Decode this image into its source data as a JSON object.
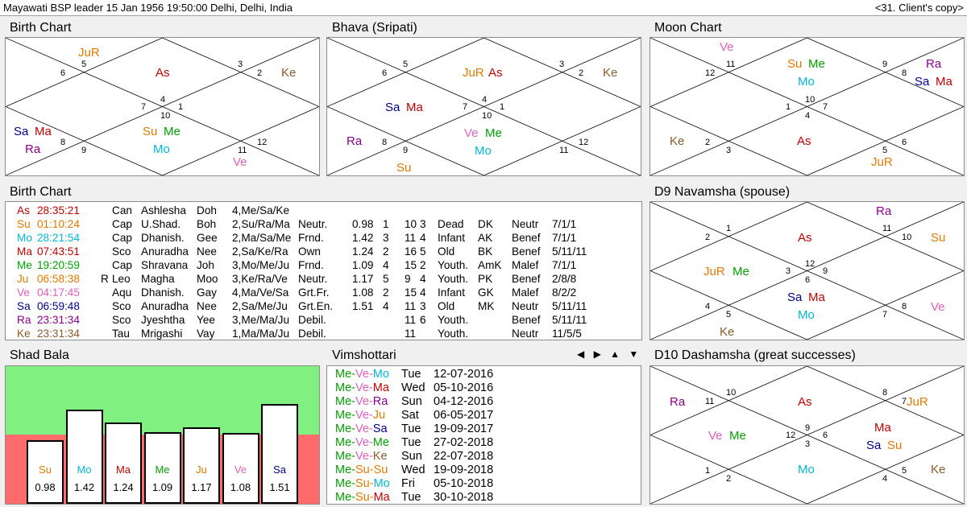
{
  "header": {
    "title": "Mayawati BSP leader  15 Jan 1956 19:50:00   Delhi, Delhi, India",
    "copy_label": "<31. Client's copy>"
  },
  "colors": {
    "Su": "#e07a00",
    "Mo": "#00b8d8",
    "Ma": "#c00000",
    "Me": "#00a000",
    "Ju": "#e07a00",
    "Ve": "#e060c0",
    "Sa": "#00008b",
    "Ra": "#8b008b",
    "Ke": "#8b5a2b",
    "As": "#c00000",
    "green_band": "#80f080",
    "red_band": "#ff6a6a"
  },
  "birth_chart": {
    "title": "Birth Chart",
    "labels": [
      {
        "text": "JuR",
        "color": "#e07a00"
      },
      {
        "text": "As",
        "color": "#c00000"
      },
      {
        "text": "Ke",
        "color": "#8b5a2b"
      },
      {
        "text": "Sa",
        "color": "#00008b"
      },
      {
        "text": "Ma",
        "color": "#c00000"
      },
      {
        "text": "Ra",
        "color": "#8b008b"
      },
      {
        "text": "Su",
        "color": "#e07a00"
      },
      {
        "text": "Me",
        "color": "#00a000"
      },
      {
        "text": "Mo",
        "color": "#00b8d8"
      },
      {
        "text": "Ve",
        "color": "#e060c0"
      }
    ],
    "houses": [
      "5",
      "6",
      "3",
      "2",
      "4",
      "7",
      "1",
      "10",
      "8",
      "9",
      "11",
      "12"
    ]
  },
  "bhava_chart": {
    "title": "Bhava (Sripati)",
    "labels": [
      {
        "text": "JuR",
        "color": "#e07a00"
      },
      {
        "text": "As",
        "color": "#c00000"
      },
      {
        "text": "Ke",
        "color": "#8b5a2b"
      },
      {
        "text": "Sa",
        "color": "#00008b"
      },
      {
        "text": "Ma",
        "color": "#c00000"
      },
      {
        "text": "Ra",
        "color": "#8b008b"
      },
      {
        "text": "Ve",
        "color": "#e060c0"
      },
      {
        "text": "Me",
        "color": "#00a000"
      },
      {
        "text": "Mo",
        "color": "#00b8d8"
      },
      {
        "text": "Su",
        "color": "#e07a00"
      }
    ],
    "houses": [
      "5",
      "6",
      "3",
      "2",
      "4",
      "7",
      "1",
      "10",
      "8",
      "9",
      "11",
      "12"
    ]
  },
  "moon_chart": {
    "title": "Moon Chart",
    "labels": [
      {
        "text": "Ve",
        "color": "#e060c0"
      },
      {
        "text": "Su",
        "color": "#e07a00"
      },
      {
        "text": "Me",
        "color": "#00a000"
      },
      {
        "text": "Mo",
        "color": "#00b8d8"
      },
      {
        "text": "Ra",
        "color": "#8b008b"
      },
      {
        "text": "Sa",
        "color": "#00008b"
      },
      {
        "text": "Ma",
        "color": "#c00000"
      },
      {
        "text": "Ke",
        "color": "#8b5a2b"
      },
      {
        "text": "As",
        "color": "#c00000"
      },
      {
        "text": "JuR",
        "color": "#e07a00"
      }
    ],
    "houses": [
      "11",
      "12",
      "9",
      "8",
      "10",
      "1",
      "7",
      "4",
      "2",
      "3",
      "5",
      "6"
    ]
  },
  "navamsha_chart": {
    "title": "D9 Navamsha  (spouse)",
    "labels": [
      {
        "text": "Ra",
        "color": "#8b008b"
      },
      {
        "text": "As",
        "color": "#c00000"
      },
      {
        "text": "Su",
        "color": "#e07a00"
      },
      {
        "text": "JuR",
        "color": "#e07a00"
      },
      {
        "text": "Me",
        "color": "#00a000"
      },
      {
        "text": "Sa",
        "color": "#00008b"
      },
      {
        "text": "Ma",
        "color": "#c00000"
      },
      {
        "text": "Mo",
        "color": "#00b8d8"
      },
      {
        "text": "Ve",
        "color": "#e060c0"
      },
      {
        "text": "Ke",
        "color": "#8b5a2b"
      }
    ],
    "houses": [
      "1",
      "2",
      "11",
      "10",
      "12",
      "3",
      "9",
      "6",
      "4",
      "5",
      "7",
      "8"
    ]
  },
  "dashamsha_chart": {
    "title": "D10 Dashamsha  (great successes)",
    "labels": [
      {
        "text": "Ra",
        "color": "#8b008b"
      },
      {
        "text": "As",
        "color": "#c00000"
      },
      {
        "text": "JuR",
        "color": "#e07a00"
      },
      {
        "text": "Ve",
        "color": "#e060c0"
      },
      {
        "text": "Me",
        "color": "#00a000"
      },
      {
        "text": "Ma",
        "color": "#c00000"
      },
      {
        "text": "Sa",
        "color": "#00008b"
      },
      {
        "text": "Su",
        "color": "#e07a00"
      },
      {
        "text": "Mo",
        "color": "#00b8d8"
      },
      {
        "text": "Ke",
        "color": "#8b5a2b"
      }
    ],
    "houses": [
      "10",
      "11",
      "8",
      "7",
      "9",
      "12",
      "6",
      "3",
      "1",
      "2",
      "4",
      "5"
    ]
  },
  "birth_table": {
    "title": "Birth Chart",
    "rows": [
      {
        "planet": "As",
        "color": "#c00000",
        "deg": "28:35:21",
        "r": "",
        "sign": "Can",
        "nak": "Ashlesha",
        "sub": "Doh",
        "pada": "4,Me/Sa/Ke",
        "rel": "",
        "val": "",
        "a": "",
        "h": "",
        "x": "",
        "age": "",
        "karaka": "",
        "nature": "",
        "dig": ""
      },
      {
        "planet": "Su",
        "color": "#e07a00",
        "deg": "01:10:24",
        "r": "",
        "sign": "Cap",
        "nak": "U.Shad.",
        "sub": "Boh",
        "pada": "2,Su/Ra/Ma",
        "rel": "Neutr.",
        "val": "0.98",
        "a": "1",
        "h": "10",
        "x": "3",
        "age": "Dead",
        "karaka": "DK",
        "nature": "Neutr",
        "dig": "7/1/1"
      },
      {
        "planet": "Mo",
        "color": "#00b8d8",
        "deg": "28:21:54",
        "r": "",
        "sign": "Cap",
        "nak": "Dhanish.",
        "sub": "Gee",
        "pada": "2,Ma/Sa/Me",
        "rel": "Frnd.",
        "val": "1.42",
        "a": "3",
        "h": "11",
        "x": "4",
        "age": "Infant",
        "karaka": "AK",
        "nature": "Benef",
        "dig": "7/1/1"
      },
      {
        "planet": "Ma",
        "color": "#c00000",
        "deg": "07:43:51",
        "r": "",
        "sign": "Sco",
        "nak": "Anuradha",
        "sub": "Nee",
        "pada": "2,Sa/Ke/Ra",
        "rel": "Own",
        "val": "1.24",
        "a": "2",
        "h": "16",
        "x": "5",
        "age": "Old",
        "karaka": "BK",
        "nature": "Benef",
        "dig": "5/11/11"
      },
      {
        "planet": "Me",
        "color": "#00a000",
        "deg": "19:20:59",
        "r": "",
        "sign": "Cap",
        "nak": "Shravana",
        "sub": "Joh",
        "pada": "3,Mo/Me/Ju",
        "rel": "Frnd.",
        "val": "1.09",
        "a": "4",
        "h": "15",
        "x": "2",
        "age": "Youth.",
        "karaka": "AmK",
        "nature": "Malef",
        "dig": "7/1/1"
      },
      {
        "planet": "Ju",
        "color": "#e07a00",
        "deg": "06:58:38",
        "r": "R",
        "sign": "Leo",
        "nak": "Magha",
        "sub": "Moo",
        "pada": "3,Ke/Ra/Ve",
        "rel": "Neutr.",
        "val": "1.17",
        "a": "5",
        "h": "9",
        "x": "4",
        "age": "Youth.",
        "karaka": "PK",
        "nature": "Benef",
        "dig": "2/8/8"
      },
      {
        "planet": "Ve",
        "color": "#e060c0",
        "deg": "04:17:45",
        "r": "",
        "sign": "Aqu",
        "nak": "Dhanish.",
        "sub": "Gay",
        "pada": "4,Ma/Ve/Sa",
        "rel": "Grt.Fr.",
        "val": "1.08",
        "a": "2",
        "h": "15",
        "x": "4",
        "age": "Infant",
        "karaka": "GK",
        "nature": "Malef",
        "dig": "8/2/2"
      },
      {
        "planet": "Sa",
        "color": "#00008b",
        "deg": "06:59:48",
        "r": "",
        "sign": "Sco",
        "nak": "Anuradha",
        "sub": "Nee",
        "pada": "2,Sa/Me/Ju",
        "rel": "Grt.En.",
        "val": "1.51",
        "a": "4",
        "h": "11",
        "x": "3",
        "age": "Old",
        "karaka": "MK",
        "nature": "Neutr",
        "dig": "5/11/11"
      },
      {
        "planet": "Ra",
        "color": "#8b008b",
        "deg": "23:31:34",
        "r": "",
        "sign": "Sco",
        "nak": "Jyeshtha",
        "sub": "Yee",
        "pada": "3,Me/Ma/Ju",
        "rel": "Debil.",
        "val": "",
        "a": "",
        "h": "11",
        "x": "6",
        "age": "Youth.",
        "karaka": "",
        "nature": "Benef",
        "dig": "5/11/11"
      },
      {
        "planet": "Ke",
        "color": "#8b5a2b",
        "deg": "23:31:34",
        "r": "",
        "sign": "Tau",
        "nak": "Mrigashi",
        "sub": "Vay",
        "pada": "1,Ma/Ma/Ju",
        "rel": "Debil.",
        "val": "",
        "a": "",
        "h": "11",
        "x": "",
        "age": "Youth.",
        "karaka": "",
        "nature": "Neutr",
        "dig": "11/5/5"
      }
    ]
  },
  "shad_bala": {
    "title": "Shad Bala",
    "bars": [
      {
        "planet": "Su",
        "color": "#e07a00",
        "value": "0.98"
      },
      {
        "planet": "Mo",
        "color": "#00b8d8",
        "value": "1.42"
      },
      {
        "planet": "Ma",
        "color": "#c00000",
        "value": "1.24"
      },
      {
        "planet": "Me",
        "color": "#00a000",
        "value": "1.09"
      },
      {
        "planet": "Ju",
        "color": "#e07a00",
        "value": "1.17"
      },
      {
        "planet": "Ve",
        "color": "#e060c0",
        "value": "1.08"
      },
      {
        "planet": "Sa",
        "color": "#00008b",
        "value": "1.51"
      }
    ],
    "threshold": 1.0
  },
  "vimshottari": {
    "title": "Vimshottari",
    "nav": "◀ ▶ ▲ ▼",
    "rows": [
      {
        "p": [
          [
            "Me",
            "#00a000"
          ],
          [
            "Ve",
            "#e060c0"
          ],
          [
            "Mo",
            "#00b8d8"
          ]
        ],
        "day": "Tue",
        "date": "12-07-2016"
      },
      {
        "p": [
          [
            "Me",
            "#00a000"
          ],
          [
            "Ve",
            "#e060c0"
          ],
          [
            "Ma",
            "#c00000"
          ]
        ],
        "day": "Wed",
        "date": "05-10-2016"
      },
      {
        "p": [
          [
            "Me",
            "#00a000"
          ],
          [
            "Ve",
            "#e060c0"
          ],
          [
            "Ra",
            "#8b008b"
          ]
        ],
        "day": "Sun",
        "date": "04-12-2016"
      },
      {
        "p": [
          [
            "Me",
            "#00a000"
          ],
          [
            "Ve",
            "#e060c0"
          ],
          [
            "Ju",
            "#e07a00"
          ]
        ],
        "day": "Sat",
        "date": "06-05-2017"
      },
      {
        "p": [
          [
            "Me",
            "#00a000"
          ],
          [
            "Ve",
            "#e060c0"
          ],
          [
            "Sa",
            "#00008b"
          ]
        ],
        "day": "Tue",
        "date": "19-09-2017"
      },
      {
        "p": [
          [
            "Me",
            "#00a000"
          ],
          [
            "Ve",
            "#e060c0"
          ],
          [
            "Me",
            "#00a000"
          ]
        ],
        "day": "Tue",
        "date": "27-02-2018"
      },
      {
        "p": [
          [
            "Me",
            "#00a000"
          ],
          [
            "Ve",
            "#e060c0"
          ],
          [
            "Ke",
            "#8b5a2b"
          ]
        ],
        "day": "Sun",
        "date": "22-07-2018"
      },
      {
        "p": [
          [
            "Me",
            "#00a000"
          ],
          [
            "Su",
            "#e07a00"
          ],
          [
            "Su",
            "#e07a00"
          ]
        ],
        "day": "Wed",
        "date": "19-09-2018"
      },
      {
        "p": [
          [
            "Me",
            "#00a000"
          ],
          [
            "Su",
            "#e07a00"
          ],
          [
            "Mo",
            "#00b8d8"
          ]
        ],
        "day": "Fri",
        "date": "05-10-2018"
      },
      {
        "p": [
          [
            "Me",
            "#00a000"
          ],
          [
            "Su",
            "#e07a00"
          ],
          [
            "Ma",
            "#c00000"
          ]
        ],
        "day": "Tue",
        "date": "30-10-2018"
      }
    ]
  }
}
